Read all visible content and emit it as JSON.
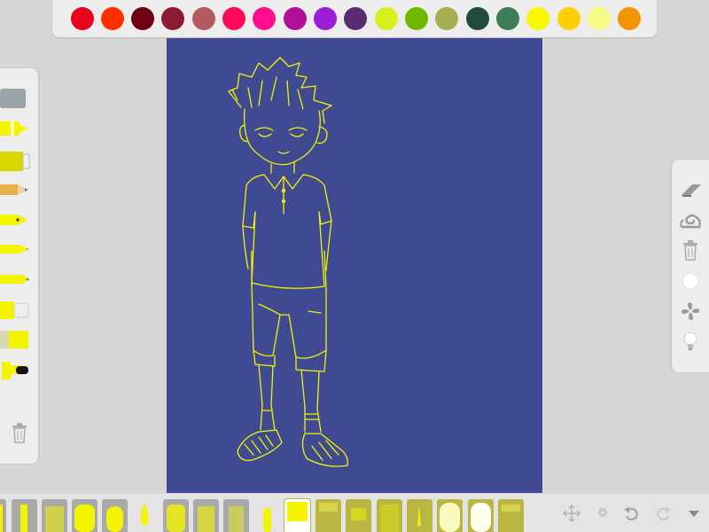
{
  "palette": {
    "colors": [
      "#e8001c",
      "#ff3000",
      "#6d0013",
      "#8c1a30",
      "#b25a5e",
      "#ff0a5a",
      "#ff0d8c",
      "#b10f97",
      "#9b1ed6",
      "#5a2b72",
      "#d6ef1d",
      "#70b800",
      "#a7b051",
      "#1f4a3c",
      "#3c7d58",
      "#f8f900",
      "#ffcf00",
      "#f8fa86",
      "#f29300"
    ]
  },
  "tools": {
    "items": [
      "eraser-tool",
      "marker-tool",
      "paint-tube-tool",
      "pencil-tool",
      "ink-pen-tool",
      "ballpoint-tool",
      "felt-pen-tool",
      "highlighter-tool",
      "crayon-tool",
      "dropper-tool"
    ],
    "trash": "trash-icon"
  },
  "canvas": {
    "background": "#3f4a93",
    "stroke": "#f4f300"
  },
  "right_panel": {
    "items": [
      "eraser-icon",
      "snail-icon",
      "trash-icon",
      "circle-icon",
      "fan-icon",
      "lightbulb-icon"
    ]
  },
  "bottom_bar": {
    "brushes": 18,
    "selected": 10,
    "actions": [
      "move-icon",
      "zoom-icon",
      "undo-icon",
      "redo-icon",
      "dropdown-icon"
    ]
  }
}
